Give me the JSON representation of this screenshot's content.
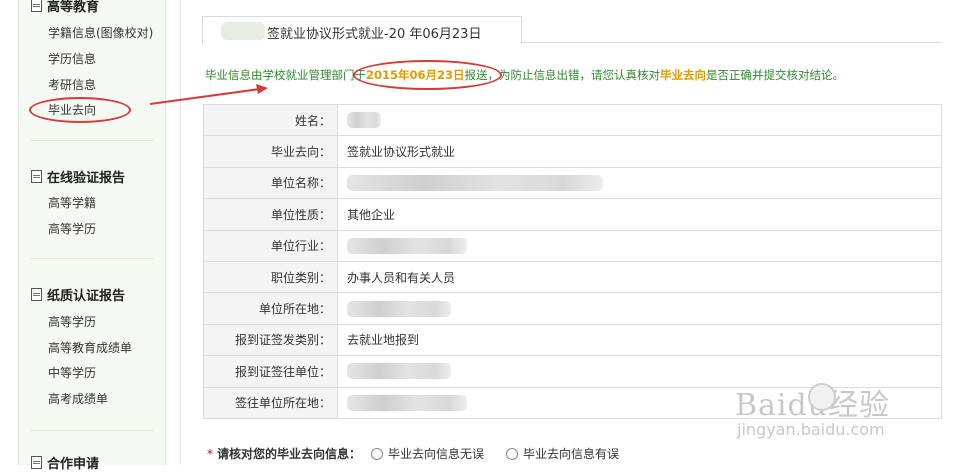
{
  "sidebar": {
    "section1": {
      "title": "高等教育",
      "items": [
        "学籍信息(图像校对)",
        "学历信息",
        "考研信息",
        "毕业去向"
      ]
    },
    "section2": {
      "title": "在线验证报告",
      "items": [
        "高等学籍",
        "高等学历"
      ]
    },
    "section3": {
      "title": "纸质认证报告",
      "items": [
        "高等学历",
        "高等教育成绩单",
        "中等学历",
        "高考成绩单"
      ]
    },
    "section4": {
      "title": "合作申请"
    }
  },
  "tab": {
    "title": "签就业协议形式就业-20  年06月23日"
  },
  "notice": {
    "part1": "毕业信息由学校就业管理部门于",
    "date": "2015年06月23日",
    "part2": "报送，为防止信息出错，请您认真核对",
    "highlight": "毕业去向",
    "part3": "是否正确并提交核对结论。"
  },
  "table": {
    "rows": [
      {
        "label": "姓名：",
        "value": ""
      },
      {
        "label": "毕业去向：",
        "value": "签就业协议形式就业"
      },
      {
        "label": "单位名称：",
        "value": ""
      },
      {
        "label": "单位性质：",
        "value": "其他企业"
      },
      {
        "label": "单位行业：",
        "value": ""
      },
      {
        "label": "职位类别：",
        "value": "办事人员和有关人员"
      },
      {
        "label": "单位所在地：",
        "value": ""
      },
      {
        "label": "报到证签发类别：",
        "value": "去就业地报到"
      },
      {
        "label": "报到证签往单位：",
        "value": ""
      },
      {
        "label": "签往单位所在地：",
        "value": ""
      }
    ]
  },
  "confirm": {
    "star": "*",
    "question": "请核对您的毕业去向信息：",
    "options": [
      "毕业去向信息无误",
      "毕业去向信息有误"
    ]
  },
  "watermark": {
    "logo": "Baidu经验",
    "url": "jingyan.baidu.com"
  },
  "colors": {
    "notice_green": "#2f8a2f",
    "highlight_orange": "#e39a00",
    "annotation_red": "#d63a3a"
  }
}
